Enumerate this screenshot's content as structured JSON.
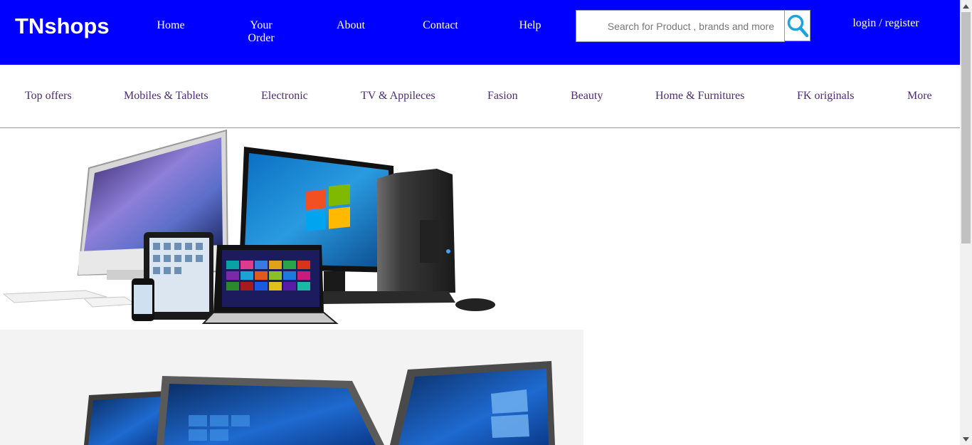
{
  "header": {
    "logo": "TNshops",
    "nav": [
      {
        "label": "Home"
      },
      {
        "label": "Your Order"
      },
      {
        "label": "About"
      },
      {
        "label": "Contact"
      },
      {
        "label": "Help"
      }
    ],
    "search": {
      "placeholder": "Search for Product , brands and more",
      "icon": "search-icon"
    },
    "login_label": "login / register",
    "background_color": "#0000ff"
  },
  "categories": [
    "Top offers",
    "Mobiles & Tablets",
    "Electronic",
    "TV & Appileces",
    "Fasion",
    "Beauty",
    "Home & Furnitures",
    "FK originals",
    "More"
  ],
  "banners": [
    {
      "name": "electronics-devices-banner"
    },
    {
      "name": "laptops-banner"
    }
  ],
  "colors": {
    "category_text": "#4b2c74",
    "accent_blue": "#0000ff"
  }
}
